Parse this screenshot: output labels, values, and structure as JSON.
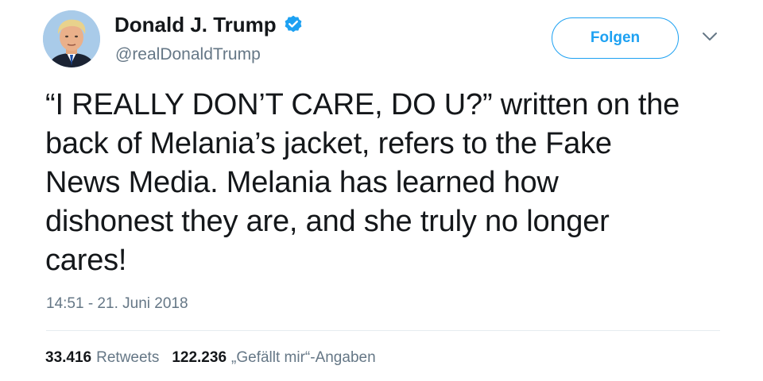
{
  "user": {
    "name": "Donald J. Trump",
    "handle": "@realDonaldTrump",
    "verified": true
  },
  "follow_button": {
    "label": "Folgen"
  },
  "menu": {
    "icon": "chevron-down-icon"
  },
  "tweet": {
    "lines": [
      "“I REALLY DON’T CARE, DO U?” written on the",
      "back of Melania’s jacket, refers to the Fake",
      "News Media. Melania has learned how",
      "dishonest they are, and she truly no longer",
      "cares!"
    ],
    "timestamp": "14:51 - 21. Juni 2018"
  },
  "stats": {
    "retweets_count": "33.416",
    "retweets_label": "Retweets",
    "likes_count": "122.236",
    "likes_label": "„Gefällt mir“-Angaben"
  },
  "colors": {
    "accent": "#1da1f2",
    "text": "#14171a",
    "secondary_text": "#657786",
    "divider": "#e6ecf0"
  }
}
